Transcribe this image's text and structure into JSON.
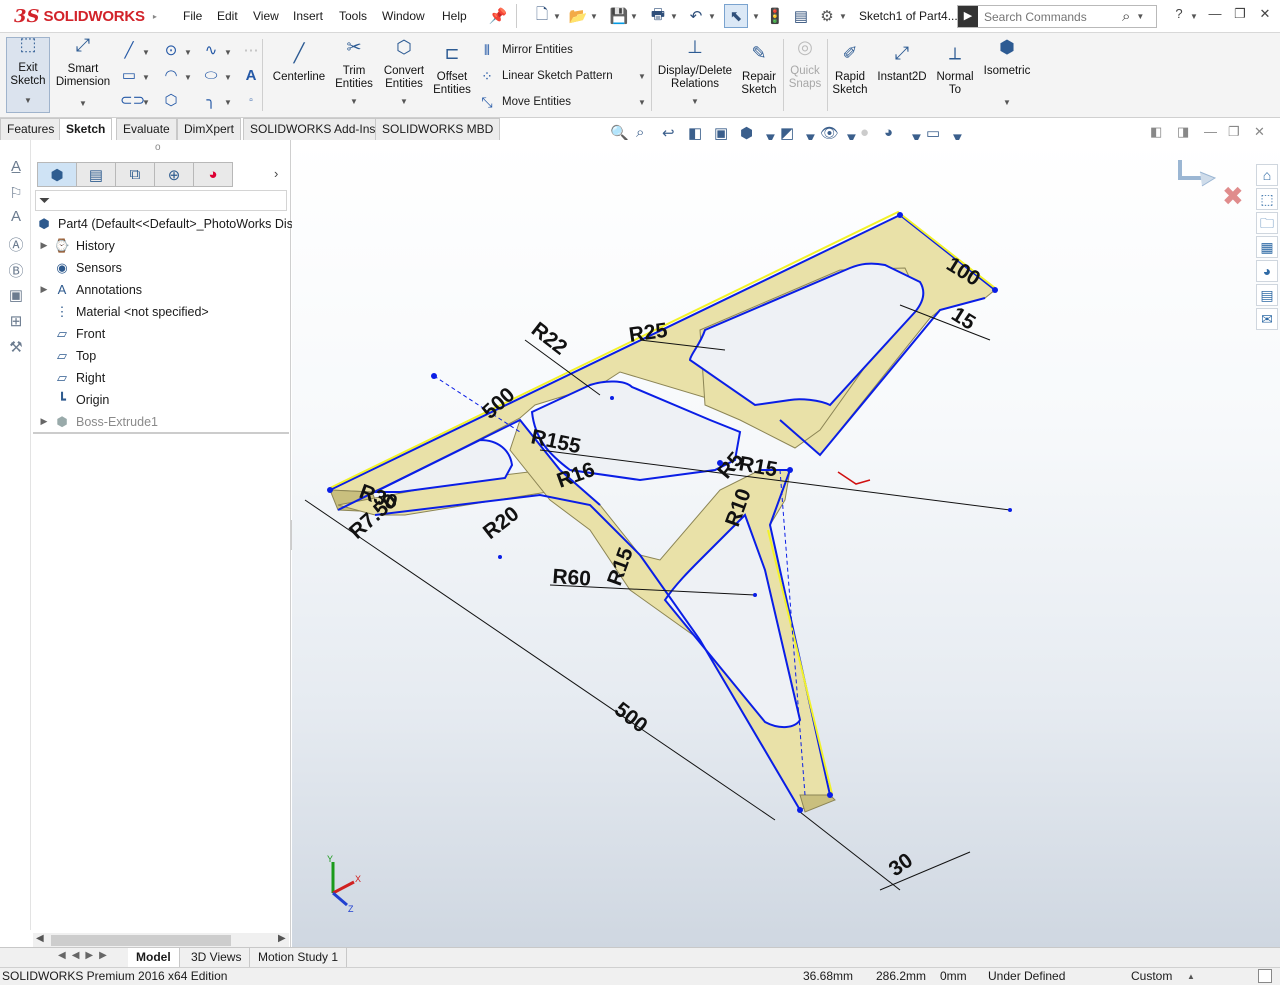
{
  "app": {
    "brand": "SOLIDWORKS",
    "ds": "3S",
    "doc_title": "Sketch1 of Part4...",
    "search_placeholder": "Search Commands"
  },
  "menu": [
    "File",
    "Edit",
    "View",
    "Insert",
    "Tools",
    "Window",
    "Help"
  ],
  "commands": {
    "exit_sketch": "Exit Sketch",
    "smart_dimension": "Smart Dimension",
    "centerline": "Centerline",
    "trim_entities": "Trim Entities",
    "convert_entities": "Convert Entities",
    "offset_entities": "Offset Entities",
    "mirror_entities": "Mirror Entities",
    "linear_sketch_pattern": "Linear Sketch Pattern",
    "move_entities": "Move Entities",
    "display_delete_relations": "Display/Delete Relations",
    "repair_sketch": "Repair Sketch",
    "quick_snaps": "Quick Snaps",
    "rapid_sketch": "Rapid Sketch",
    "instant2d": "Instant2D",
    "normal_to": "Normal To",
    "isometric": "Isometric"
  },
  "tabs": [
    "Features",
    "Sketch",
    "Evaluate",
    "DimXpert",
    "SOLIDWORKS Add-Ins",
    "SOLIDWORKS MBD"
  ],
  "active_tab": "Sketch",
  "tree": {
    "root": "Part4  (Default<<Default>_PhotoWorks Disp",
    "items": [
      "History",
      "Sensors",
      "Annotations",
      "Material <not specified>",
      "Front",
      "Top",
      "Right",
      "Origin",
      "Boss-Extrude1"
    ]
  },
  "bottom_tabs": [
    "Model",
    "3D Views",
    "Motion Study 1"
  ],
  "status": {
    "edition": "SOLIDWORKS Premium 2016 x64 Edition",
    "x": "36.68mm",
    "y": "286.2mm",
    "z": "0mm",
    "state": "Under Defined",
    "units": "Custom"
  },
  "dimensions": {
    "d100": "100",
    "d15": "15",
    "r25": "R25",
    "r22": "R22",
    "d500a": "500",
    "r155": "R155",
    "r15a": "R15",
    "r30": "R30",
    "r7_50": "R7.50",
    "r20": "R20",
    "r60": "R60",
    "r15b": "R15",
    "r10": "R10",
    "r5": "R5",
    "d500b": "500",
    "d30": "30",
    "r16": "R16"
  },
  "triad": {
    "x": "X",
    "y": "Y",
    "z": "Z"
  },
  "colors": {
    "part_fill": "#e8e0a6",
    "part_side": "#c9bf7e",
    "sketch_blue": "#0a1ee6",
    "highlight_yellow": "#f2f22a",
    "brand_red": "#d2232a"
  }
}
